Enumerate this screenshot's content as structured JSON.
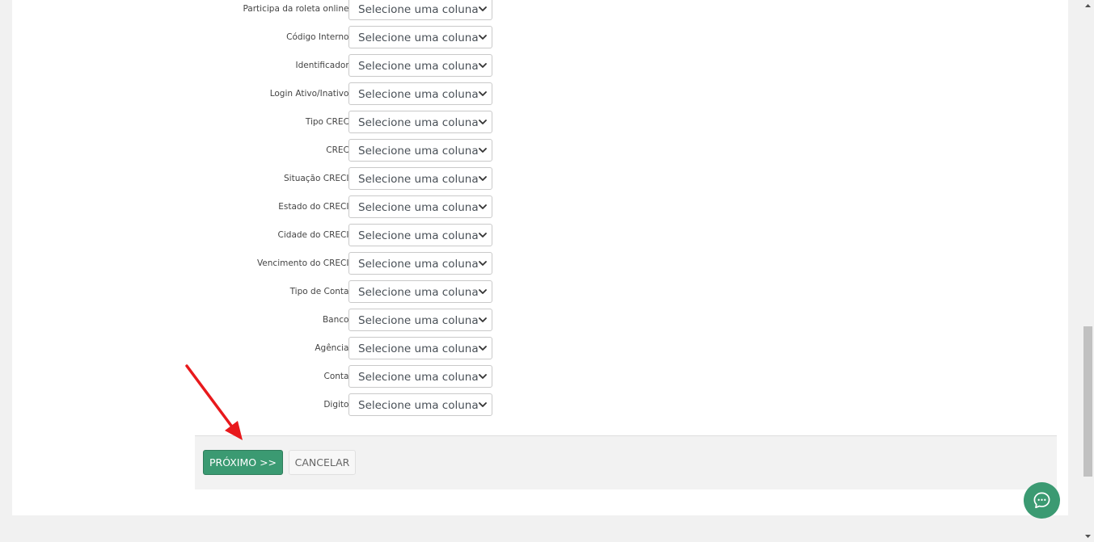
{
  "form": {
    "rows": [
      {
        "label": "Participa da roleta online:",
        "value": "Selecione uma coluna"
      },
      {
        "label": "Código Interno:",
        "value": "Selecione uma coluna"
      },
      {
        "label": "Identificador:",
        "value": "Selecione uma coluna"
      },
      {
        "label": "Login Ativo/Inativo:",
        "value": "Selecione uma coluna"
      },
      {
        "label": "Tipo CRECI",
        "value": "Selecione uma coluna"
      },
      {
        "label": "CRECI",
        "value": "Selecione uma coluna"
      },
      {
        "label": "Situação CRECI:",
        "value": "Selecione uma coluna"
      },
      {
        "label": "Estado do CRECI:",
        "value": "Selecione uma coluna"
      },
      {
        "label": "Cidade do CRECI:",
        "value": "Selecione uma coluna"
      },
      {
        "label": "Vencimento do CRECI:",
        "value": "Selecione uma coluna"
      },
      {
        "label": "Tipo de Conta:",
        "value": "Selecione uma coluna"
      },
      {
        "label": "Banco:",
        "value": "Selecione uma coluna"
      },
      {
        "label": "Agência:",
        "value": "Selecione uma coluna"
      },
      {
        "label": "Conta:",
        "value": "Selecione uma coluna"
      },
      {
        "label": "Digito:",
        "value": "Selecione uma coluna"
      }
    ]
  },
  "footer": {
    "next_label": "PRÓXIMO >>",
    "cancel_label": "CANCELAR"
  },
  "icons": {
    "chat": "chat-bubble-icon",
    "select_arrow": "chevron-down-icon",
    "annotation": "red-arrow-icon"
  },
  "colors": {
    "primary": "#3b9a72",
    "annotation": "#e8191c"
  }
}
